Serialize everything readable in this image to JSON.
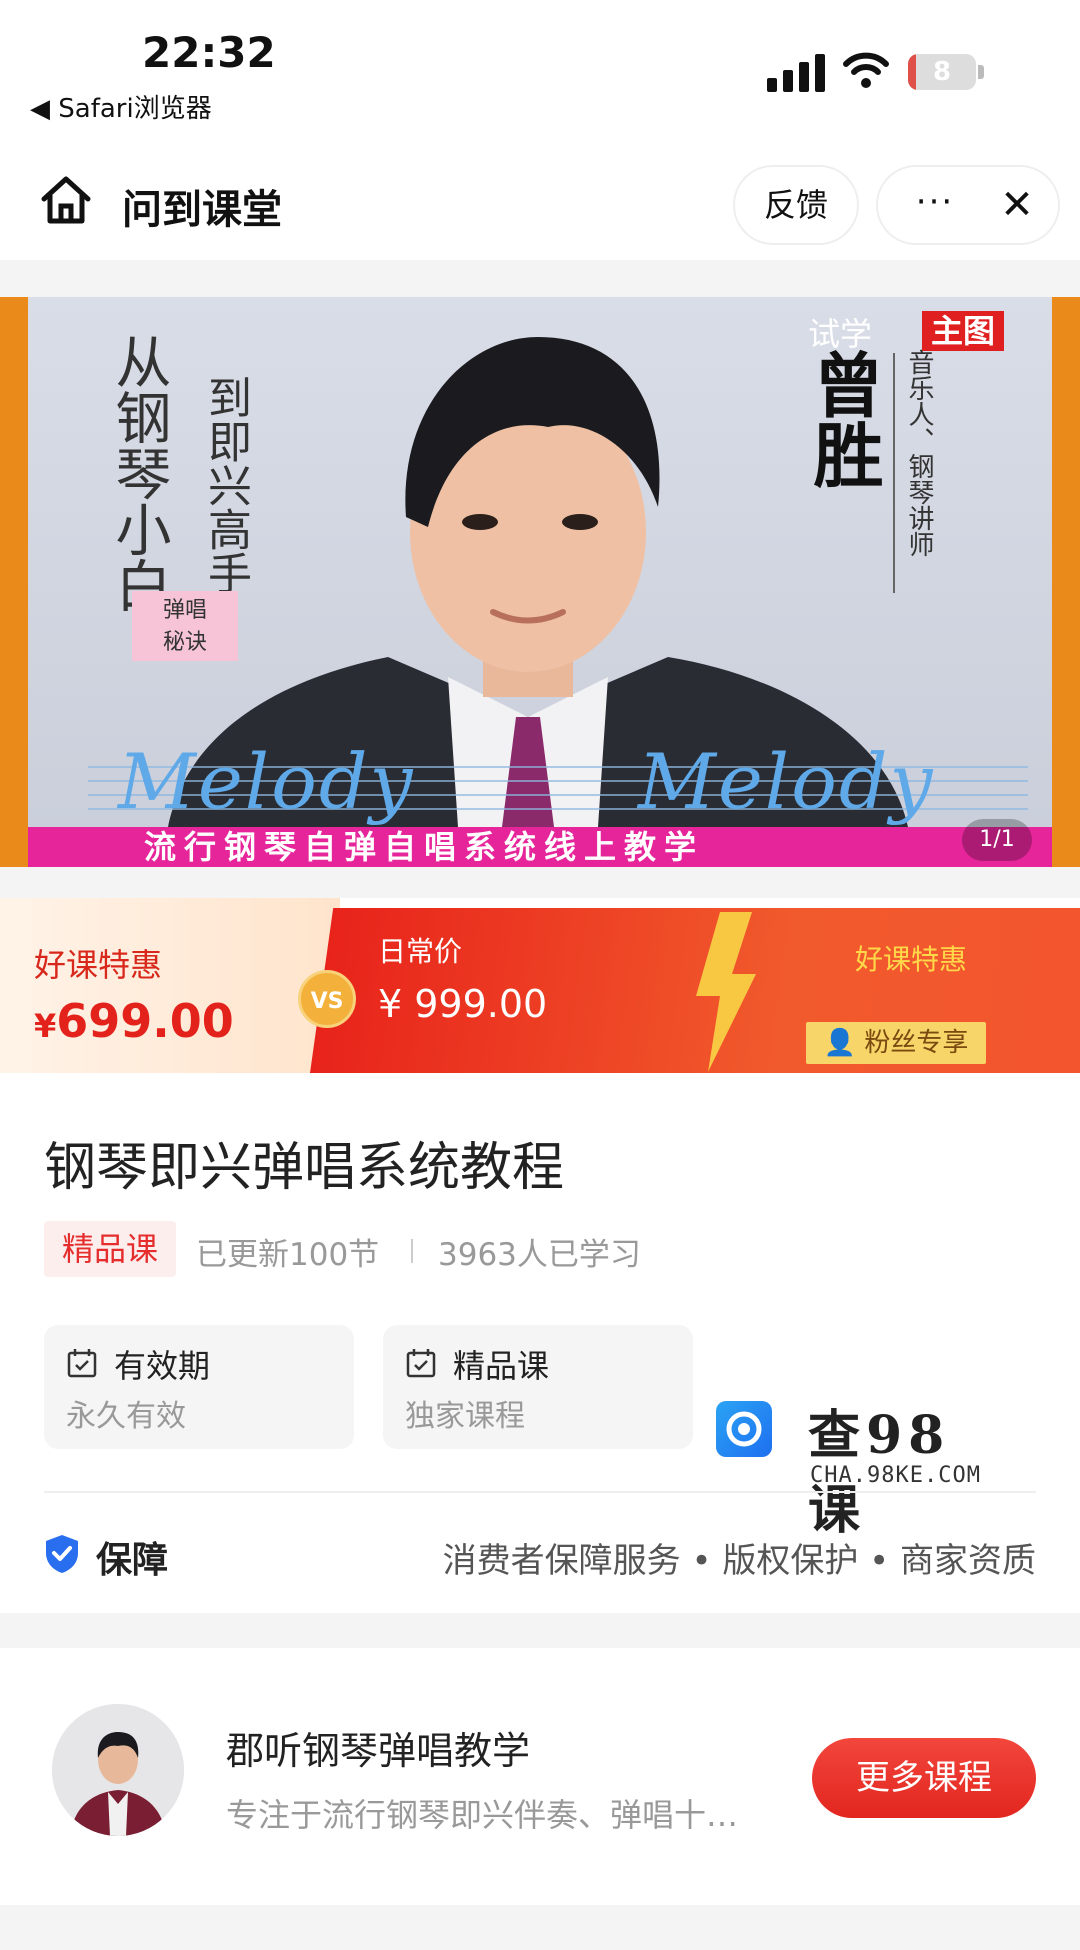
{
  "status_bar": {
    "time": "22:32",
    "back_app": "◀ Safari浏览器",
    "battery": "8",
    "battery_level": 0.08
  },
  "title_bar": {
    "title": "问到课堂",
    "feedback": "反馈",
    "more": "···",
    "close": "✕"
  },
  "banner": {
    "vertical_text_1": "从钢琴小白",
    "vertical_text_2": "到即兴高手",
    "sticker_line1": "弹唱",
    "sticker_line2": "秘诀",
    "trial": "试学",
    "main_tag": "主图",
    "teacher_name": "曾胜",
    "teacher_title": "音乐人、钢琴讲师",
    "melody": "Melody",
    "strip_text": "流行钢琴自弹自唱系统线上教学",
    "counter": "1/1"
  },
  "price": {
    "deal_label": "好课特惠",
    "deal_price_symbol": "¥",
    "deal_price": "699.00",
    "vs": "VS",
    "daily_label": "日常价",
    "daily_price": "¥ 999.00",
    "promo": "好课特惠",
    "fans_only": "粉丝专享"
  },
  "course": {
    "title": "钢琴即兴弹唱系统教程",
    "badge": "精品课",
    "updated": "已更新100节",
    "learned": "3963人已学习",
    "cards": [
      {
        "heading": "有效期",
        "sub": "永久有效"
      },
      {
        "heading": "精品课",
        "sub": "独家课程"
      }
    ],
    "watermark_text": "查98课",
    "watermark_url": "CHA.98KE.COM",
    "guarantee": "保障",
    "services": "消费者保障服务 • 版权保护 • 商家资质"
  },
  "teacher": {
    "name": "郡听钢琴弹唱教学",
    "desc": "专注于流行钢琴即兴伴奏、弹唱十…",
    "more_button": "更多课程"
  },
  "colors": {
    "accent_red": "#e3231b",
    "banner_border": "#e98a1a",
    "strip_magenta": "#e6259a",
    "promo_yellow": "#ffd84a"
  }
}
